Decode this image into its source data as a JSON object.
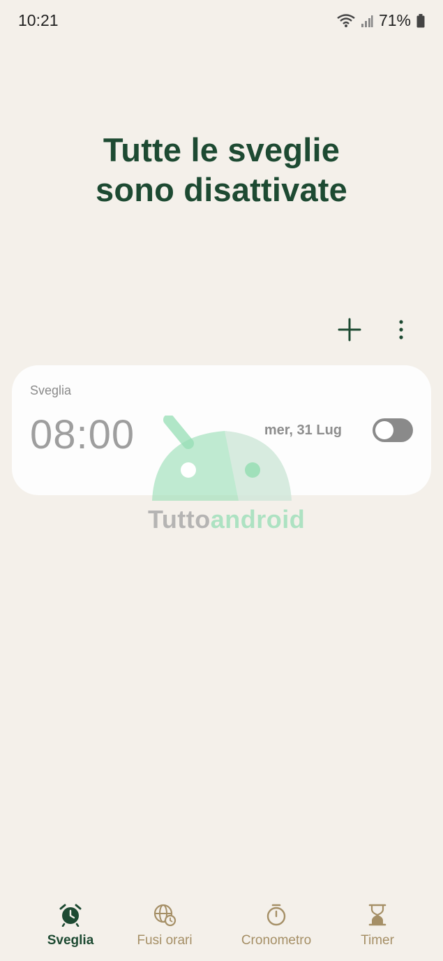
{
  "status_bar": {
    "time": "10:21",
    "battery": "71%",
    "icons": [
      "wifi-icon",
      "signal-icon",
      "battery-icon"
    ]
  },
  "headline": {
    "line1": "Tutte le sveglie",
    "line2": "sono disattivate"
  },
  "actions": {
    "add_icon": "plus-icon",
    "more_icon": "more-vert-icon"
  },
  "alarm": {
    "name": "Sveglia",
    "time": "08:00",
    "date": "mer, 31 Lug",
    "enabled": false
  },
  "watermark": {
    "part1": "Tutto",
    "part2": "android"
  },
  "bottom_nav": {
    "items": [
      {
        "label": "Sveglia",
        "icon": "alarm-clock-icon",
        "active": true
      },
      {
        "label": "Fusi orari",
        "icon": "globe-clock-icon",
        "active": false
      },
      {
        "label": "Cronometro",
        "icon": "stopwatch-icon",
        "active": false
      },
      {
        "label": "Timer",
        "icon": "hourglass-icon",
        "active": false
      }
    ]
  },
  "colors": {
    "background": "#f4f0ea",
    "accent": "#1d4a32",
    "inactive_nav": "#a58f66",
    "card": "#fdfdfd"
  }
}
